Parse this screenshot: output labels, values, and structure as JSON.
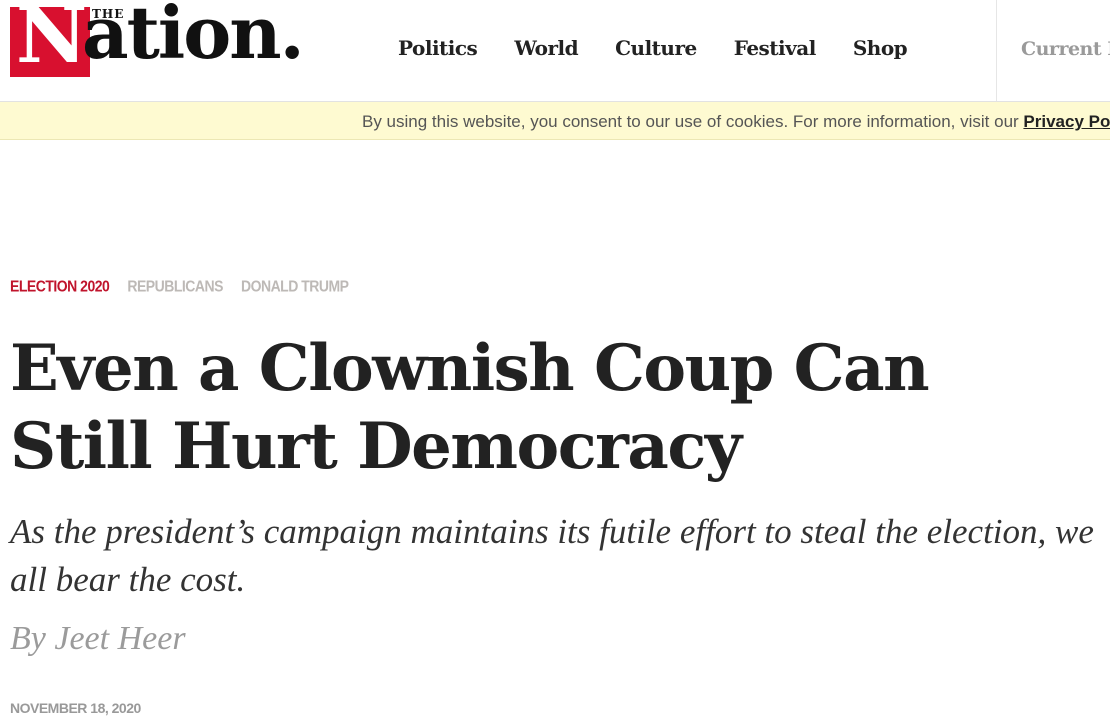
{
  "header": {
    "logo": {
      "the": "THE",
      "n": "N",
      "rest": "ation."
    },
    "nav": [
      "Politics",
      "World",
      "Culture",
      "Festival",
      "Shop"
    ],
    "current_issue": "Current Issue"
  },
  "cookie_banner": {
    "text": "By using this website, you consent to our use of cookies. For more information, visit our ",
    "link_label": "Privacy Policy"
  },
  "article": {
    "tags": [
      "ELECTION 2020",
      "REPUBLICANS",
      "DONALD TRUMP"
    ],
    "headline": "Even a Clownish Coup Can Still Hurt Democracy",
    "dek": "As the president’s campaign maintains its futile effort to steal the election, we all bear the cost.",
    "byline": "By Jeet Heer",
    "date": "NOVEMBER 18, 2020"
  },
  "colors": {
    "brand_red": "#d8102f",
    "tag_active": "#c0142c",
    "tag_muted": "#bdb9b6",
    "cookie_bg": "#fefad1"
  }
}
